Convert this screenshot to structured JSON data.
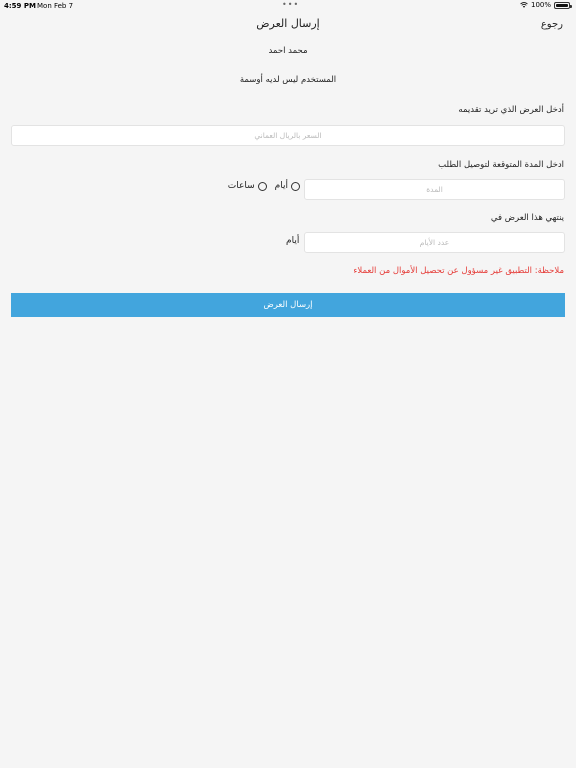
{
  "status_bar": {
    "time": "4:59 PM",
    "date": "Mon Feb 7",
    "multitask_dots": "•••",
    "battery": "100%",
    "battery_level": 1.0
  },
  "nav": {
    "title": "إرسال العرض",
    "back_label": "رجوع"
  },
  "user": {
    "name": "محمد احمد",
    "badges_text": "المستخدم ليس لديه أوسمة"
  },
  "offer": {
    "label": "أدخل العرض الذي تريد تقديمه",
    "placeholder": "السعر بالريال العماني"
  },
  "duration": {
    "label": "ادخل المدة المتوقعة لتوصيل الطلب",
    "placeholder": "المدة",
    "options": [
      "أيام",
      "ساعات"
    ]
  },
  "expiry": {
    "label": "ينتهي هذا العرض في",
    "placeholder": "عدد الأيام",
    "unit": "أيام"
  },
  "note": "ملاحظة: التطبيق غير مسؤول عن تحصيل الأموال من العملاء",
  "submit_label": "إرسال العرض",
  "colors": {
    "accent": "#42a5dd",
    "warning": "#e53935",
    "background": "#f5f5f5"
  }
}
